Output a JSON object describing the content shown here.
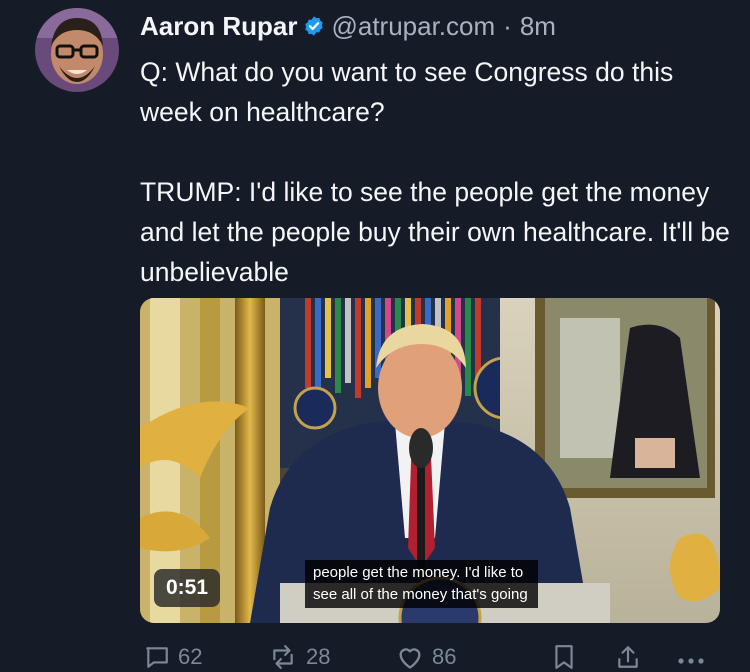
{
  "tweet": {
    "author_name": "Aaron Rupar",
    "verified_icon": "verified-badge-icon",
    "handle": "@atrupar.com",
    "separator": "·",
    "timestamp": "8m",
    "paragraphs": [
      "Q: What do you want to see Congress do this week on healthcare?",
      "TRUMP: I'd like to see the people get the money and let the people buy their own healthcare. It'll be unbelievable"
    ],
    "video": {
      "duration": "0:51",
      "caption_lines": [
        "people get the money. I'd like to",
        "see all of the money that's going"
      ]
    },
    "actions": {
      "reply_count": "62",
      "repost_count": "28",
      "like_count": "86",
      "icons": [
        "reply-icon",
        "repost-icon",
        "like-icon",
        "bookmark-icon",
        "share-icon",
        "more-icon"
      ]
    }
  },
  "colors": {
    "background": "#151c28",
    "verified": "#1d9bf0",
    "muted_text": "#a9b3c0",
    "action_gray": "#7d8896"
  }
}
